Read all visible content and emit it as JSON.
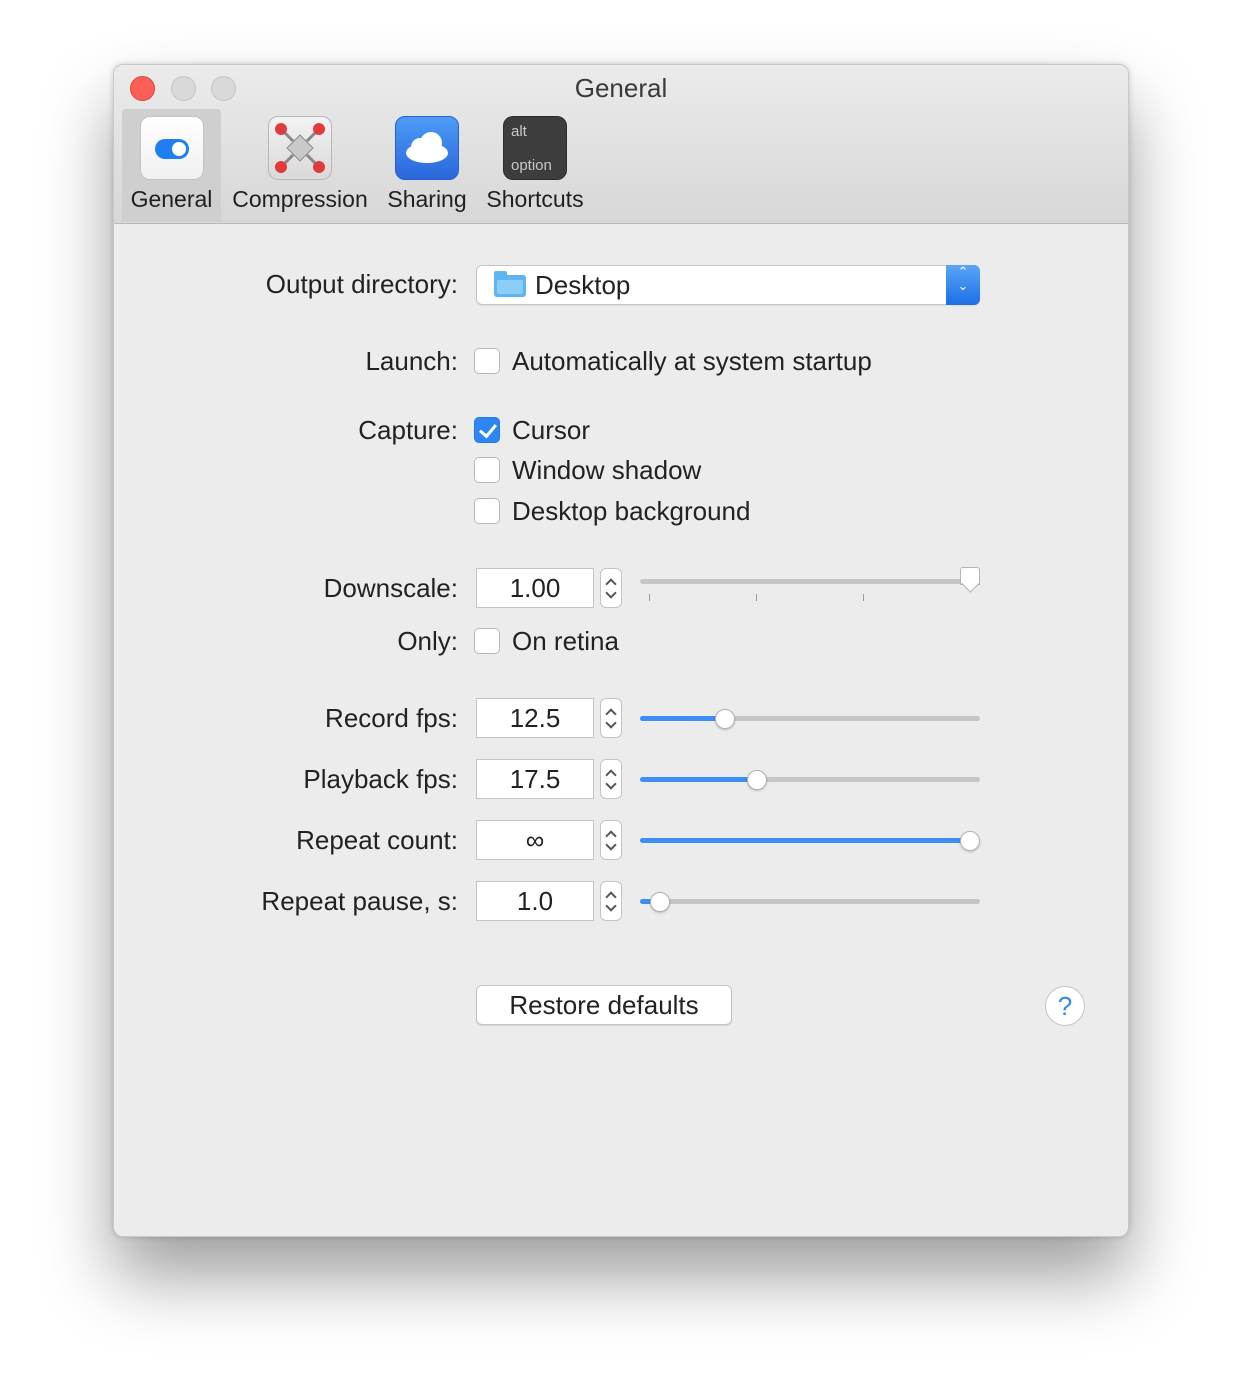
{
  "window": {
    "title": "General",
    "controls": [
      "close",
      "minimize",
      "zoom"
    ]
  },
  "toolbar": {
    "tabs": [
      {
        "label": "General",
        "icon": "toggle-switch-icon",
        "active": true
      },
      {
        "label": "Compression",
        "icon": "compression-icon",
        "active": false
      },
      {
        "label": "Sharing",
        "icon": "cloud-icon",
        "active": false
      },
      {
        "label": "Shortcuts",
        "icon": "keyboard-key-icon",
        "active": false,
        "key_top": "alt",
        "key_bottom": "option"
      }
    ]
  },
  "settings": {
    "output_directory": {
      "label": "Output directory:",
      "value": "Desktop"
    },
    "launch": {
      "label": "Launch:",
      "option": "Automatically at system startup",
      "checked": false
    },
    "capture": {
      "label": "Capture:",
      "options": [
        {
          "text": "Cursor",
          "checked": true
        },
        {
          "text": "Window shadow",
          "checked": false
        },
        {
          "text": "Desktop background",
          "checked": false
        }
      ]
    },
    "downscale": {
      "label": "Downscale:",
      "value": "1.00",
      "slider_fraction": 0.97,
      "tick_count": 4
    },
    "only": {
      "label": "Only:",
      "option": "On retina",
      "checked": false
    },
    "record_fps": {
      "label": "Record fps:",
      "value": "12.5",
      "slider_fraction": 0.25
    },
    "playback_fps": {
      "label": "Playback fps:",
      "value": "17.5",
      "slider_fraction": 0.345
    },
    "repeat_count": {
      "label": "Repeat count:",
      "value": "∞",
      "slider_fraction": 0.97
    },
    "repeat_pause": {
      "label": "Repeat pause, s:",
      "value": "1.0",
      "slider_fraction": 0.06
    }
  },
  "buttons": {
    "restore_defaults": "Restore defaults",
    "help": "?"
  },
  "colors": {
    "accent": "#2e86f5",
    "close": "#fc5f57"
  }
}
